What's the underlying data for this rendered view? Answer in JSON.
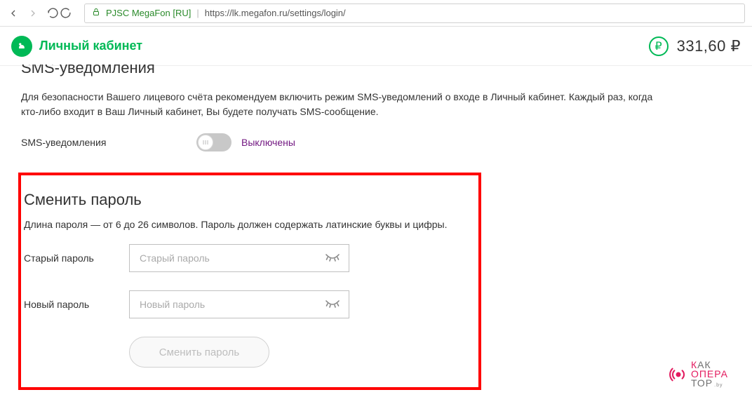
{
  "browser": {
    "site_name": "PJSC MegaFon [RU]",
    "url": "https://lk.megafon.ru/settings/login/"
  },
  "header": {
    "logo_text": "Личный кабинет",
    "balance": "331,60 ₽",
    "currency_symbol": "₽"
  },
  "sms_section": {
    "title": "SMS-уведомления",
    "description": "Для безопасности Вашего лицевого счёта рекомендуем включить режим SMS-уведомлений о входе в Личный кабинет. Каждый раз, когда кто-либо входит в Ваш Личный кабинет, Вы будете получать SMS-сообщение.",
    "label": "SMS-уведомления",
    "status": "Выключены"
  },
  "password_section": {
    "title": "Сменить пароль",
    "description": "Длина пароля — от 6 до 26 символов. Пароль должен содержать латинские буквы и цифры.",
    "old_label": "Старый пароль",
    "old_placeholder": "Старый пароль",
    "new_label": "Новый пароль",
    "new_placeholder": "Новый пароль",
    "submit": "Сменить пароль"
  },
  "watermark": {
    "line1_a": "К",
    "line1_b": "АК",
    "line2_a": "ОПЕРА",
    "line3_a": "ТОР",
    "suffix": ".by"
  }
}
